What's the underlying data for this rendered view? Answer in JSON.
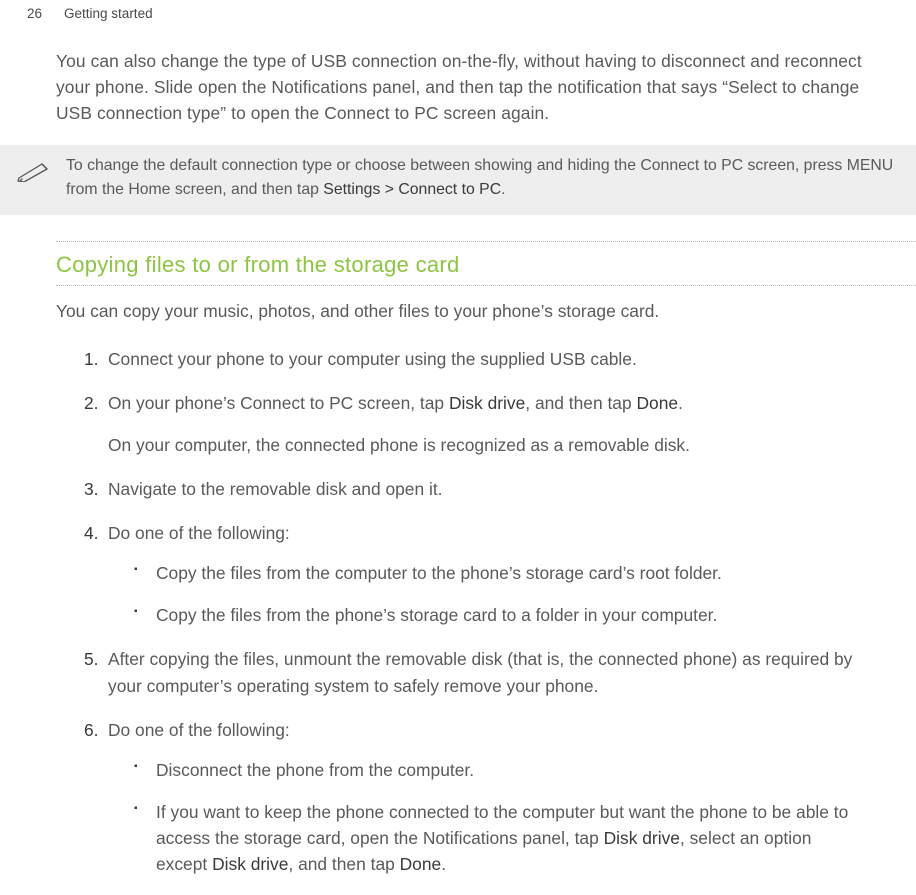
{
  "header": {
    "page_number": "26",
    "chapter": "Getting started"
  },
  "intro_para": "You can also change the type of USB connection on-the-fly, without having to disconnect and reconnect your phone. Slide open the Notifications panel, and then tap the notification that says “Select to change USB connection type” to open the Connect to PC screen again.",
  "note": {
    "pre": "To change the default connection type or choose between showing and hiding the Connect to PC screen, press MENU from the Home screen, and then tap ",
    "bold": "Settings > Connect to PC",
    "post": "."
  },
  "section": {
    "title": "Copying files to or from the storage card",
    "intro": "You can copy your music, photos, and other files to your phone’s storage card.",
    "steps": {
      "s1": "Connect your phone to your computer using the supplied USB cable.",
      "s2": {
        "pre": "On your phone’s Connect to PC screen, tap ",
        "b1": "Disk drive",
        "mid": ", and then tap ",
        "b2": "Done",
        "post": ".",
        "sub": "On your computer, the connected phone is recognized as a removable disk."
      },
      "s3": "Navigate to the removable disk and open it.",
      "s4": {
        "text": "Do one of the following:",
        "bullets": {
          "b1": "Copy the files from the computer to the phone’s storage card’s root folder.",
          "b2": "Copy the files from the phone’s storage card to a folder in your computer."
        }
      },
      "s5": "After copying the files, unmount the removable disk (that is, the connected phone) as required by your computer’s operating system to safely remove your phone.",
      "s6": {
        "text": "Do one of the following:",
        "bullets": {
          "b1": "Disconnect the phone from the computer.",
          "b2": {
            "pre": "If you want to keep the phone connected to the computer but want the phone to be able to access the storage card, open the Notifications panel, tap ",
            "bold1": "Disk drive",
            "mid1": ", select an option except ",
            "bold2": "Disk drive",
            "mid2": ", and then tap ",
            "bold3": "Done",
            "post": "."
          }
        }
      }
    }
  }
}
